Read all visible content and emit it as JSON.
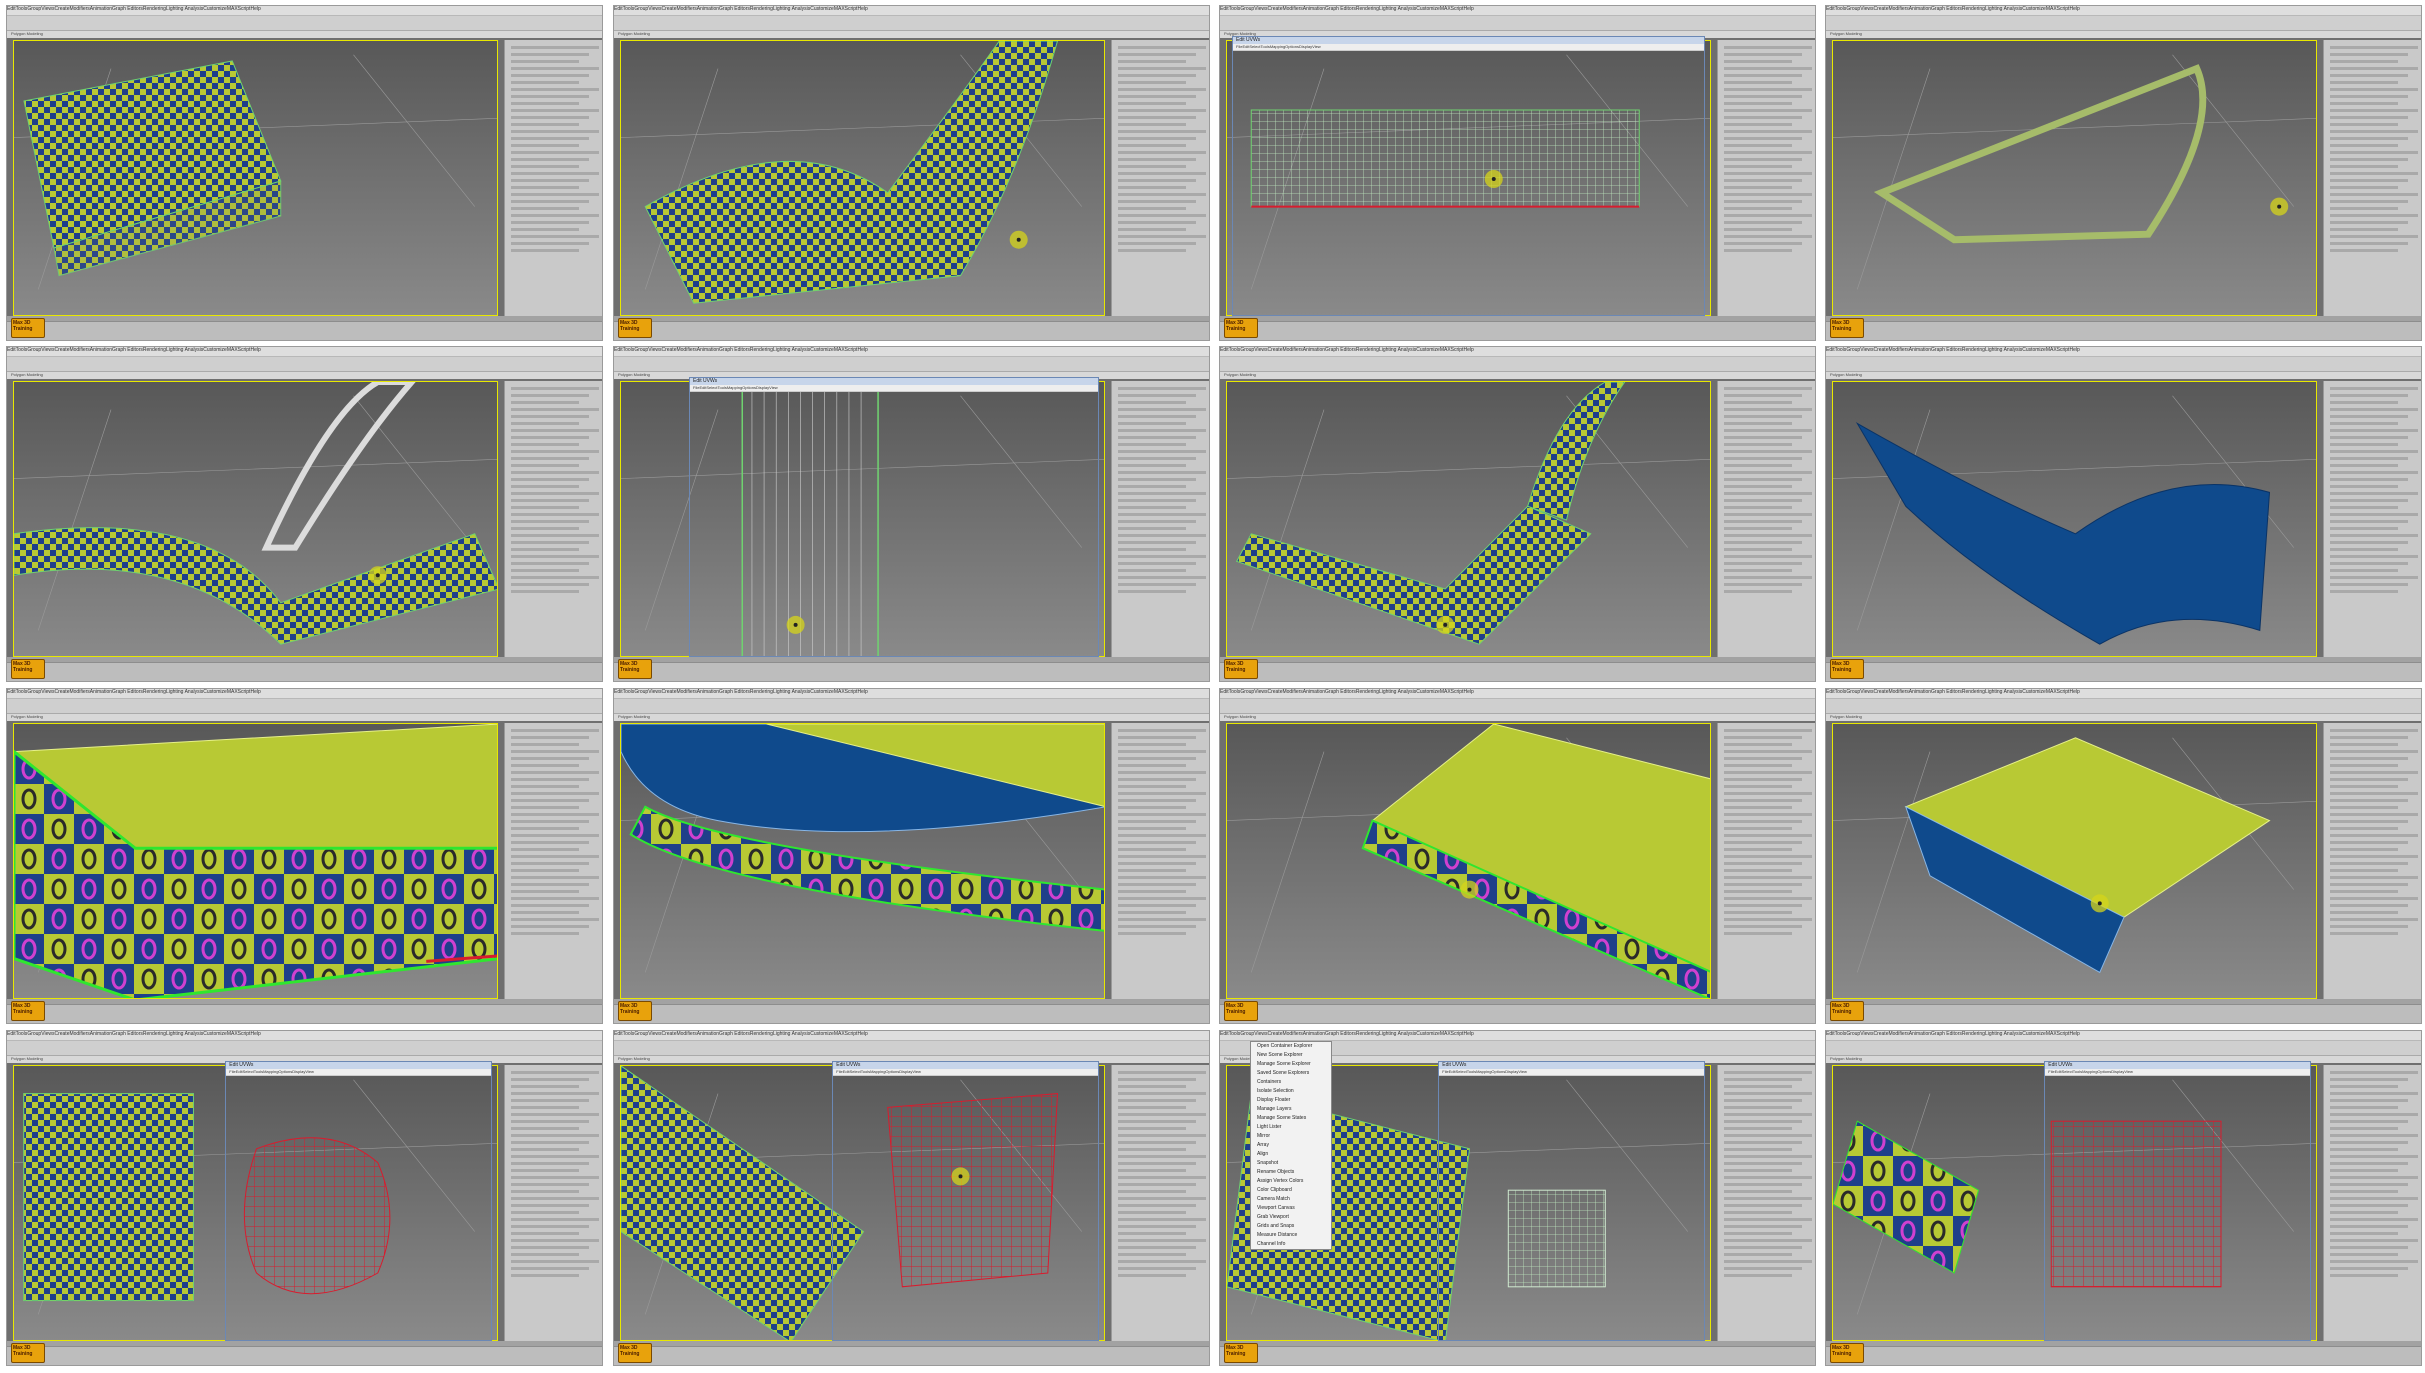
{
  "app": {
    "menu": [
      "Edit",
      "Tools",
      "Group",
      "Views",
      "Create",
      "Modifiers",
      "Animation",
      "Graph Editors",
      "Rendering",
      "Lighting Analysis",
      "Customize",
      "MAXScript",
      "Help"
    ],
    "mode_label": "Polygon Modeling",
    "logo_text": "Max 3D Training"
  },
  "editor_dialog": {
    "title": "Edit UVWs",
    "menu": [
      "File",
      "Edit",
      "Select",
      "Tools",
      "Mapping",
      "Options",
      "Display",
      "View"
    ]
  },
  "tools_menu": {
    "items": [
      "Open Container Explorer",
      "New Scene Explorer",
      "Manage Scene Explorer",
      "Saved Scene Explorers",
      "Containers",
      "Isolate Selection",
      "Display Floater",
      "Manage Layers",
      "Manage Scene States",
      "Light Lister",
      "Mirror",
      "Array",
      "Align",
      "Snapshot",
      "Rename Objects",
      "Assign Vertex Colors",
      "Color Clipboard",
      "Camera Match",
      "Viewport Canvas",
      "Grab Viewport",
      "Grids and Snaps",
      "Measure Distance",
      "Channel Info"
    ]
  },
  "colors": {
    "viewport_bg": "#6f6f6f",
    "checker_yellow": "#b8c934",
    "checker_blue": "#1f3f8a",
    "selection_green": "#2fe62f",
    "uv_red": "#d81c2e",
    "wire_green": "#6fd36f",
    "cursor_yellow": "#d6d41a",
    "surface_blue": "#0f4a8c",
    "panel_gray": "#c9c9c9"
  },
  "tiles": [
    {
      "id": "t1",
      "kind": "material-editor"
    },
    {
      "id": "t2",
      "kind": "checker-sheet"
    },
    {
      "id": "t3",
      "kind": "uv-grid-editor"
    },
    {
      "id": "t4",
      "kind": "wire-frame-loop"
    },
    {
      "id": "t5",
      "kind": "checker-strip"
    },
    {
      "id": "t6",
      "kind": "uv-vertical-strip"
    },
    {
      "id": "t7",
      "kind": "checker-frame-loop"
    },
    {
      "id": "t8",
      "kind": "blue-surface"
    },
    {
      "id": "t9",
      "kind": "closeup-edge"
    },
    {
      "id": "t10",
      "kind": "closeup-blue-edge"
    },
    {
      "id": "t11",
      "kind": "closeup-plate"
    },
    {
      "id": "t12",
      "kind": "blue-yellow-surface"
    },
    {
      "id": "t13",
      "kind": "uv-red-blob"
    },
    {
      "id": "t14",
      "kind": "uv-red-quad"
    },
    {
      "id": "t15",
      "kind": "tools-menu"
    },
    {
      "id": "t16",
      "kind": "uv-red-square"
    }
  ]
}
